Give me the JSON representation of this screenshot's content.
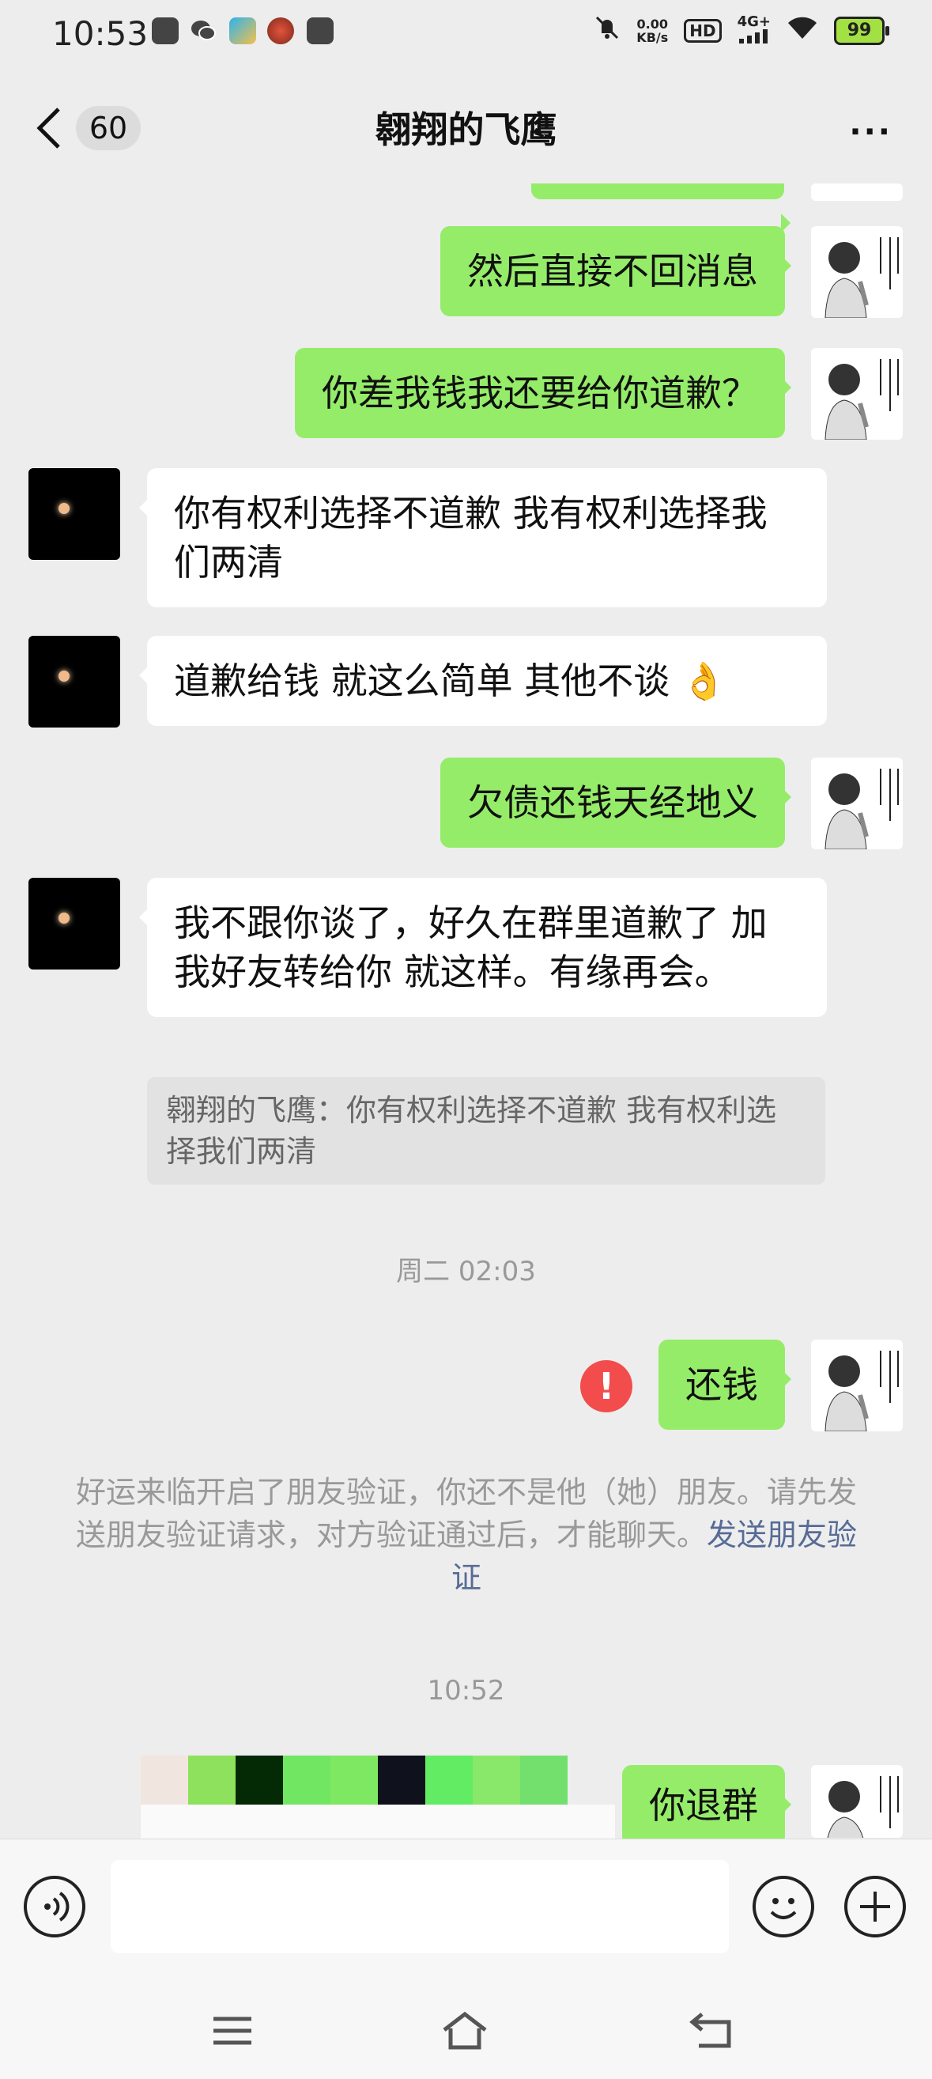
{
  "status_bar": {
    "time": "10:53",
    "net_speed_value": "0.00",
    "net_speed_unit": "KB/s",
    "hd_label": "HD",
    "signal_label": "4G+",
    "battery": "99",
    "left_icons": [
      "mail-icon",
      "wechat-icon",
      "app-icon",
      "app-icon",
      "wallet-icon"
    ],
    "right_icons": [
      "mute-icon",
      "wifi-icon"
    ]
  },
  "header": {
    "unread_count": "60",
    "title": "翱翔的飞鹰",
    "more_label": "···"
  },
  "messages": [
    {
      "from": "me",
      "text": "然后直接不回消息"
    },
    {
      "from": "me",
      "text": "你差我钱我还要给你道歉？"
    },
    {
      "from": "other",
      "text": "你有权利选择不道歉  我有权利选择我们两清"
    },
    {
      "from": "other",
      "text": "道歉给钱 就这么简单 其他不谈",
      "emoji": "👌"
    },
    {
      "from": "me",
      "text": "欠债还钱天经地义"
    },
    {
      "from": "other",
      "text": "我不跟你谈了，好久在群里道歉了  加我好友转给你 就这样。有缘再会。"
    },
    {
      "from": "quote",
      "text": "翱翔的飞鹰：你有权利选择不道歉  我有权利选择我们两清"
    },
    {
      "from": "timestamp",
      "text": "周二 02:03"
    },
    {
      "from": "me",
      "text": "还钱",
      "error": "!"
    },
    {
      "from": "system",
      "text": "好运来临开启了朋友验证，你还不是他（她）朋友。请先发送朋友验证请求，对方验证通过后，才能聊天。",
      "link": "发送朋友验证"
    },
    {
      "from": "timestamp",
      "text": "10:52"
    },
    {
      "from": "me",
      "text": "你退群"
    }
  ],
  "colors": {
    "bubble_me": "#95ec69",
    "bubble_other": "#ffffff",
    "background": "#ededed",
    "error": "#f24c4c",
    "link": "#576b95"
  }
}
